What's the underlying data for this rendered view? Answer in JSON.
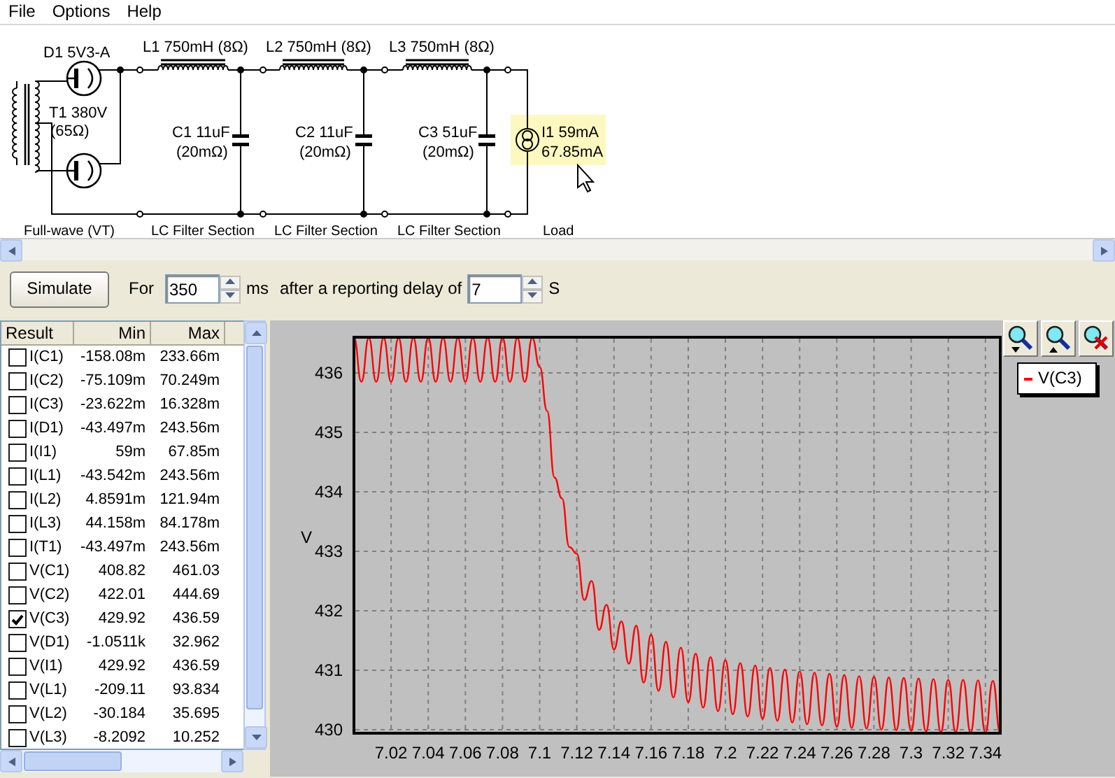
{
  "menu": [
    "File",
    "Options",
    "Help"
  ],
  "schematic": {
    "rectifier": {
      "diode": "D1 5V3-A",
      "transformer": "T1 380V",
      "transformer_resistance": "(65Ω)",
      "caption": "Full-wave (VT)"
    },
    "filters": [
      {
        "inductor": "L1 750mH (8Ω)",
        "capacitor": "C1 11uF",
        "capacitor_resistance": "(20mΩ)",
        "caption": "LC Filter Section"
      },
      {
        "inductor": "L2 750mH (8Ω)",
        "capacitor": "C2 11uF",
        "capacitor_resistance": "(20mΩ)",
        "caption": "LC Filter Section"
      },
      {
        "inductor": "L3 750mH (8Ω)",
        "capacitor": "C3 51uF",
        "capacitor_resistance": "(20mΩ)",
        "caption": "LC Filter Section"
      }
    ],
    "load": {
      "source": "I1 59mA",
      "reading": "67.85mA",
      "highlighted": true,
      "caption": "Load"
    }
  },
  "simulation": {
    "button": "Simulate",
    "for_label": "For",
    "duration": "350",
    "duration_unit": "ms",
    "delay_label": "after a reporting delay of",
    "delay": "7",
    "delay_unit": "S"
  },
  "results": {
    "columns": [
      "Result",
      "Min",
      "Max"
    ],
    "rows": [
      {
        "name": "I(C1)",
        "min": "-158.08m",
        "max": "233.66m",
        "checked": false
      },
      {
        "name": "I(C2)",
        "min": "-75.109m",
        "max": "70.249m",
        "checked": false
      },
      {
        "name": "I(C3)",
        "min": "-23.622m",
        "max": "16.328m",
        "checked": false
      },
      {
        "name": "I(D1)",
        "min": "-43.497m",
        "max": "243.56m",
        "checked": false
      },
      {
        "name": "I(I1)",
        "min": "59m",
        "max": "67.85m",
        "checked": false
      },
      {
        "name": "I(L1)",
        "min": "-43.542m",
        "max": "243.56m",
        "checked": false
      },
      {
        "name": "I(L2)",
        "min": "4.8591m",
        "max": "121.94m",
        "checked": false
      },
      {
        "name": "I(L3)",
        "min": "44.158m",
        "max": "84.178m",
        "checked": false
      },
      {
        "name": "I(T1)",
        "min": "-43.497m",
        "max": "243.56m",
        "checked": false
      },
      {
        "name": "V(C1)",
        "min": "408.82",
        "max": "461.03",
        "checked": false
      },
      {
        "name": "V(C2)",
        "min": "422.01",
        "max": "444.69",
        "checked": false
      },
      {
        "name": "V(C3)",
        "min": "429.92",
        "max": "436.59",
        "checked": true
      },
      {
        "name": "V(D1)",
        "min": "-1.0511k",
        "max": "32.962",
        "checked": false
      },
      {
        "name": "V(I1)",
        "min": "429.92",
        "max": "436.59",
        "checked": false
      },
      {
        "name": "V(L1)",
        "min": "-209.11",
        "max": "93.834",
        "checked": false
      },
      {
        "name": "V(L2)",
        "min": "-30.184",
        "max": "35.695",
        "checked": false
      },
      {
        "name": "V(L3)",
        "min": "-8.2092",
        "max": "10.252",
        "checked": false
      }
    ]
  },
  "chart": {
    "chart_data": {
      "type": "line",
      "grid": true,
      "ylabel": "V",
      "xlim": [
        7,
        7.348
      ],
      "ylim": [
        429.94,
        436.6
      ],
      "xticks": [
        7.02,
        7.04,
        7.06,
        7.08,
        7.1,
        7.12,
        7.14,
        7.16,
        7.18,
        7.2,
        7.22,
        7.24,
        7.26,
        7.28,
        7.3,
        7.32,
        7.34
      ],
      "yticks": [
        430,
        431,
        432,
        433,
        434,
        435,
        436
      ],
      "x": [
        7,
        7.004,
        7.008,
        7.012,
        7.016,
        7.02,
        7.024,
        7.028,
        7.032,
        7.036,
        7.04,
        7.044,
        7.048,
        7.052,
        7.056,
        7.06,
        7.064,
        7.068,
        7.072,
        7.076,
        7.08,
        7.084,
        7.088,
        7.092,
        7.096,
        7.1,
        7.104,
        7.108,
        7.112,
        7.116,
        7.12,
        7.124,
        7.128,
        7.132,
        7.136,
        7.14,
        7.144,
        7.148,
        7.152,
        7.156,
        7.16,
        7.164,
        7.168,
        7.172,
        7.176,
        7.18,
        7.184,
        7.188,
        7.192,
        7.196,
        7.2,
        7.204,
        7.208,
        7.212,
        7.216,
        7.22,
        7.224,
        7.228,
        7.232,
        7.236,
        7.24,
        7.244,
        7.248,
        7.252,
        7.256,
        7.26,
        7.264,
        7.268,
        7.272,
        7.276,
        7.28,
        7.284,
        7.288,
        7.292,
        7.296,
        7.3,
        7.304,
        7.308,
        7.312,
        7.316,
        7.32,
        7.324,
        7.328,
        7.332,
        7.336,
        7.34,
        7.344,
        7.348
      ],
      "series": [
        {
          "name": "V(C3)",
          "color": "#ff0000",
          "values": [
            436.59,
            435.85,
            436.59,
            435.85,
            436.59,
            435.85,
            436.59,
            435.85,
            436.59,
            435.85,
            436.59,
            435.85,
            436.59,
            435.85,
            436.59,
            435.85,
            436.59,
            435.85,
            436.59,
            435.85,
            436.59,
            435.85,
            436.59,
            435.85,
            436.59,
            436.1,
            435.36,
            434.24,
            433.89,
            433.07,
            432.96,
            432.18,
            432.5,
            431.68,
            432.1,
            431.35,
            431.82,
            431.11,
            431.75,
            430.79,
            431.6,
            430.65,
            431.48,
            430.54,
            431.38,
            430.46,
            431.28,
            430.37,
            431.22,
            430.31,
            431.17,
            430.26,
            431.12,
            430.22,
            431.08,
            430.18,
            431.04,
            430.15,
            431.01,
            430.12,
            430.98,
            430.09,
            430.96,
            430.07,
            430.94,
            430.05,
            430.92,
            430.03,
            430.9,
            430.02,
            430.89,
            430.0,
            430.88,
            429.99,
            430.87,
            429.98,
            430.86,
            429.97,
            430.85,
            429.96,
            430.84,
            429.96,
            430.84,
            429.95,
            430.83,
            429.95,
            430.82,
            429.94
          ]
        }
      ]
    }
  }
}
